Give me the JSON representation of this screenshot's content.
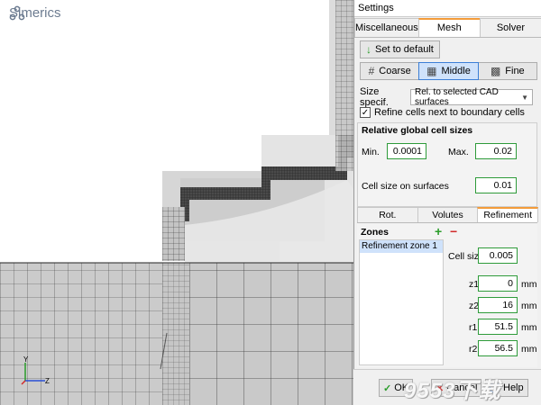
{
  "app": {
    "logo_text": "Simerics"
  },
  "viewport": {
    "axis_y": "Y",
    "axis_z": "Z"
  },
  "dialog": {
    "title": "Settings",
    "tabs": [
      {
        "label": "Miscellaneous",
        "active": false
      },
      {
        "label": "Mesh",
        "active": true
      },
      {
        "label": "Solver",
        "active": false
      }
    ],
    "set_default_label": "Set to default",
    "density": [
      {
        "label": "Coarse",
        "active": false
      },
      {
        "label": "Middle",
        "active": true
      },
      {
        "label": "Fine",
        "active": false
      }
    ],
    "size_specif_label": "Size specif.",
    "size_specif_value": "Rel. to selected CAD surfaces",
    "refine_label": "Refine cells next to boundary cells",
    "refine_checked": true,
    "relative_sizes": {
      "title": "Relative global cell sizes",
      "min_label": "Min.",
      "min_value": "0.0001",
      "max_label": "Max.",
      "max_value": "0.02",
      "surface_label": "Cell size on surfaces",
      "surface_value": "0.01"
    },
    "subtabs": [
      {
        "label": "Rot. symmetric",
        "active": false
      },
      {
        "label": "Volutes",
        "active": false
      },
      {
        "label": "Refinement",
        "active": true
      }
    ],
    "zones": {
      "title": "Zones",
      "items": [
        "Refinement zone 1"
      ],
      "cell_size_label": "Cell size",
      "cell_size_value": "0.005",
      "fields": [
        {
          "label": "z1",
          "value": "0",
          "unit": "mm"
        },
        {
          "label": "z2",
          "value": "16",
          "unit": "mm"
        },
        {
          "label": "r1",
          "value": "51.5",
          "unit": "mm"
        },
        {
          "label": "r2",
          "value": "56.5",
          "unit": "mm"
        }
      ]
    },
    "buttons": {
      "ok": "OK",
      "cancel": "Cancel",
      "help": "Help"
    }
  },
  "watermark": "9553下载"
}
